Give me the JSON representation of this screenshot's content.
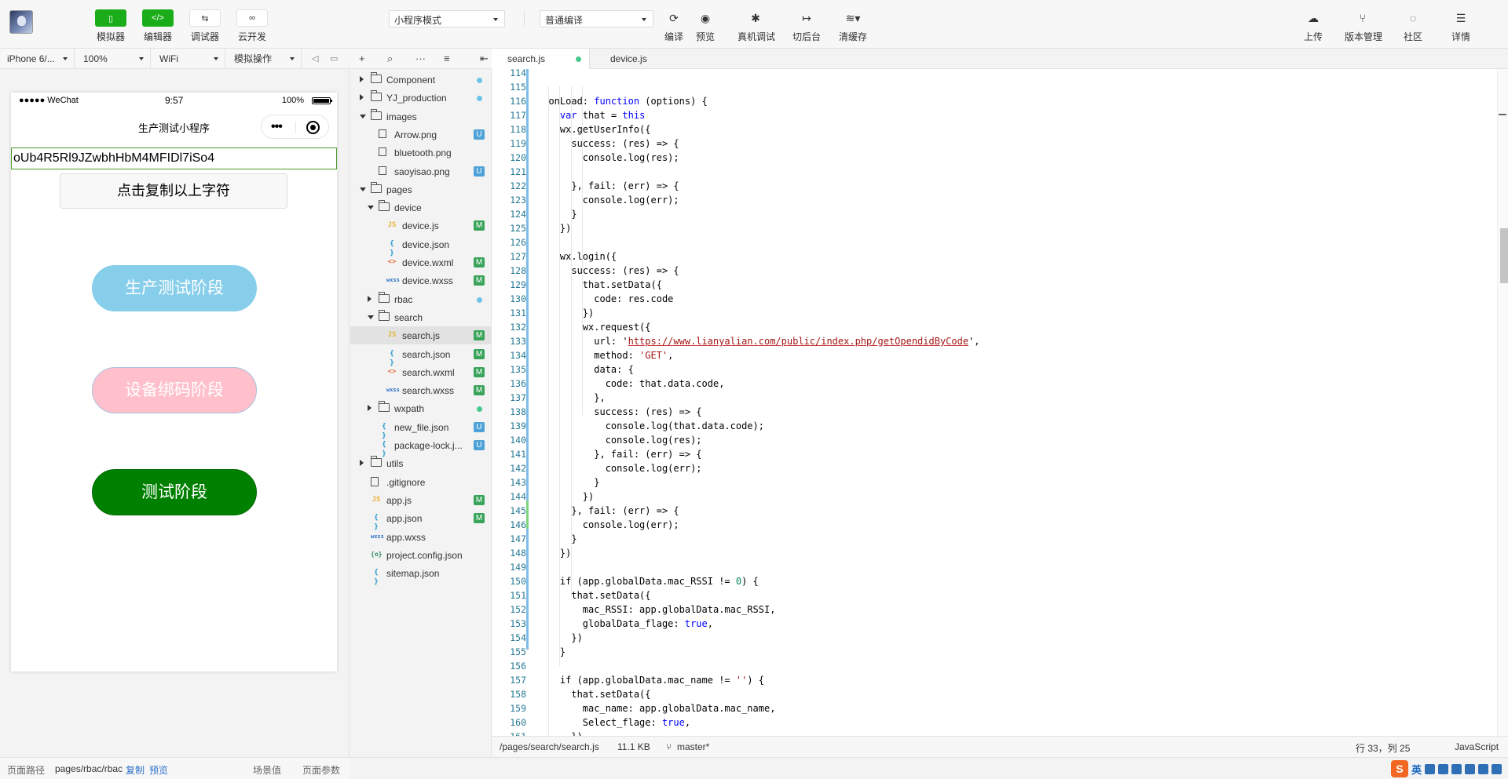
{
  "toolbar": {
    "simulator": "模拟器",
    "editor": "编辑器",
    "debugger": "调试器",
    "cloud": "云开发",
    "mode_select": "小程序模式",
    "compile_select": "普通编译",
    "compile": "编译",
    "preview": "预览",
    "real_debug": "真机调试",
    "background": "切后台",
    "clear_cache": "清缓存",
    "upload": "上传",
    "version": "版本管理",
    "community": "社区",
    "details": "详情"
  },
  "simbar": {
    "device": "iPhone 6/...",
    "zoom": "100%",
    "network": "WiFi",
    "operation": "模拟操作"
  },
  "phone": {
    "carrier": "●●●●● WeChat",
    "time": "9:57",
    "battery": "100%",
    "nav_title": "生产测试小程序",
    "openid": "oUb4R5Rl9JZwbhHbM4MFIDl7iSo4",
    "copy_button": "点击复制以上字符",
    "stage_production": "生产测试阶段",
    "stage_binding": "设备绑码阶段",
    "stage_test": "测试阶段"
  },
  "sim_footer": {
    "path_label": "页面路径",
    "path": "pages/rbac/rbac",
    "copy": "复制",
    "preview": "预览",
    "scene": "场景值",
    "params": "页面参数"
  },
  "tree": [
    {
      "name": "Component",
      "type": "folder",
      "depth": 0,
      "open": false,
      "mark": "dot"
    },
    {
      "name": "YJ_production",
      "type": "folder",
      "depth": 0,
      "open": false,
      "mark": "dot"
    },
    {
      "name": "images",
      "type": "folder",
      "depth": 0,
      "open": true,
      "mark": ""
    },
    {
      "name": "Arrow.png",
      "type": "img",
      "depth": 1,
      "mark": "U"
    },
    {
      "name": "bluetooth.png",
      "type": "img",
      "depth": 1,
      "mark": ""
    },
    {
      "name": "saoyisao.png",
      "type": "img",
      "depth": 1,
      "mark": "U"
    },
    {
      "name": "pages",
      "type": "folder",
      "depth": 0,
      "open": true,
      "mark": ""
    },
    {
      "name": "device",
      "type": "folder",
      "depth": 1,
      "open": true,
      "mark": ""
    },
    {
      "name": "device.js",
      "type": "js",
      "depth": 2,
      "mark": "M"
    },
    {
      "name": "device.json",
      "type": "json",
      "depth": 2,
      "mark": ""
    },
    {
      "name": "device.wxml",
      "type": "wxml",
      "depth": 2,
      "mark": "M"
    },
    {
      "name": "device.wxss",
      "type": "wxss",
      "depth": 2,
      "mark": "M"
    },
    {
      "name": "rbac",
      "type": "folder",
      "depth": 1,
      "open": false,
      "mark": "dot"
    },
    {
      "name": "search",
      "type": "folder",
      "depth": 1,
      "open": true,
      "mark": ""
    },
    {
      "name": "search.js",
      "type": "js",
      "depth": 2,
      "mark": "M",
      "active": true
    },
    {
      "name": "search.json",
      "type": "json",
      "depth": 2,
      "mark": "M"
    },
    {
      "name": "search.wxml",
      "type": "wxml",
      "depth": 2,
      "mark": "M"
    },
    {
      "name": "search.wxss",
      "type": "wxss",
      "depth": 2,
      "mark": "M"
    },
    {
      "name": "wxpath",
      "type": "folder",
      "depth": 1,
      "open": false,
      "mark": "dotg"
    },
    {
      "name": "new_file.json",
      "type": "json",
      "depth": 1,
      "mark": "U"
    },
    {
      "name": "package-lock.j...",
      "type": "json",
      "depth": 1,
      "mark": "U"
    },
    {
      "name": "utils",
      "type": "folder",
      "depth": 0,
      "open": false,
      "mark": ""
    },
    {
      "name": ".gitignore",
      "type": "doc",
      "depth": 0,
      "mark": ""
    },
    {
      "name": "app.js",
      "type": "js",
      "depth": 0,
      "mark": "M"
    },
    {
      "name": "app.json",
      "type": "json",
      "depth": 0,
      "mark": "M"
    },
    {
      "name": "app.wxss",
      "type": "wxss",
      "depth": 0,
      "mark": ""
    },
    {
      "name": "project.config.json",
      "type": "cfg",
      "depth": 0,
      "mark": ""
    },
    {
      "name": "sitemap.json",
      "type": "json",
      "depth": 0,
      "mark": ""
    }
  ],
  "tabs": [
    {
      "label": "search.js",
      "active": true
    },
    {
      "label": "device.js",
      "active": false
    }
  ],
  "code_first_line": 114,
  "code": [
    "",
    "",
    "  onLoad: function (options) {",
    "    var that = this",
    "    wx.getUserInfo({",
    "      success: (res) => {",
    "        console.log(res);",
    "",
    "      }, fail: (err) => {",
    "        console.log(err);",
    "      }",
    "    })",
    "",
    "    wx.login({",
    "      success: (res) => {",
    "        that.setData({",
    "          code: res.code",
    "        })",
    "        wx.request({",
    "          url: 'https://www.lianyalian.com/public/index.php/getOpendidByCode',",
    "          method: 'GET',",
    "          data: {",
    "            code: that.data.code,",
    "          },",
    "          success: (res) => {",
    "            console.log(that.data.code);",
    "            console.log(res);",
    "          }, fail: (err) => {",
    "            console.log(err);",
    "          }",
    "        })",
    "      }, fail: (err) => {",
    "        console.log(err);",
    "      }",
    "    })",
    "",
    "    if (app.globalData.mac_RSSI != 0) {",
    "      that.setData({",
    "        mac_RSSI: app.globalData.mac_RSSI,",
    "        globalData_flage: true,",
    "      })",
    "    }",
    "",
    "    if (app.globalData.mac_name != '') {",
    "      that.setData({",
    "        mac_name: app.globalData.mac_name,",
    "        Select_flage: true,",
    "      })"
  ],
  "statusbar": {
    "path": "/pages/search/search.js",
    "size": "11.1 KB",
    "branch": "master*",
    "position": "行 33，列 25",
    "language": "JavaScript"
  },
  "ime": {
    "lang": "英"
  }
}
